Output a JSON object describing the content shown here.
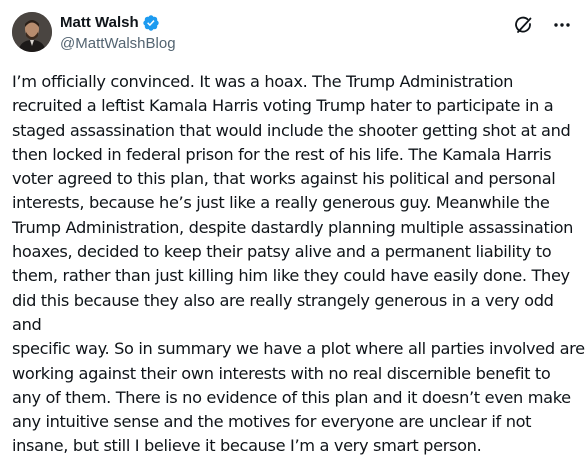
{
  "author": {
    "display_name": "Matt Walsh",
    "handle": "@MattWalshBlog",
    "verified": true,
    "verified_color": "#1d9bf0"
  },
  "actions": {
    "grok_icon": "grok-icon",
    "more_icon": "more-horizontal-icon"
  },
  "post": {
    "text": "I’m officially convinced. It was a hoax. The Trump Administration\nrecruited a leftist Kamala Harris voting Trump hater to participate in a\nstaged assassination that would include the shooter getting shot at and\nthen locked in federal prison for the rest of his life. The Kamala Harris\nvoter agreed to this plan, that works against his political and personal\ninterests, because he’s just like a really generous guy. Meanwhile the\nTrump Administration, despite dastardly planning multiple assassination\nhoaxes, decided to keep their patsy alive and a permanent liability to\nthem, rather than just killing him like they could have easily done. They\ndid this because they also are really strangely generous in a very odd and\nspecific way. So in summary we have a plot where all parties involved are\nworking against their own interests with no real discernible benefit to\nany of them. There is no evidence of this plan and it doesn’t even make\nany intuitive sense and the motives for everyone are unclear if not\ninsane, but still I believe it because I’m a very smart person."
  },
  "colors": {
    "text_primary": "#0f1419",
    "text_secondary": "#536471",
    "background": "#ffffff"
  }
}
